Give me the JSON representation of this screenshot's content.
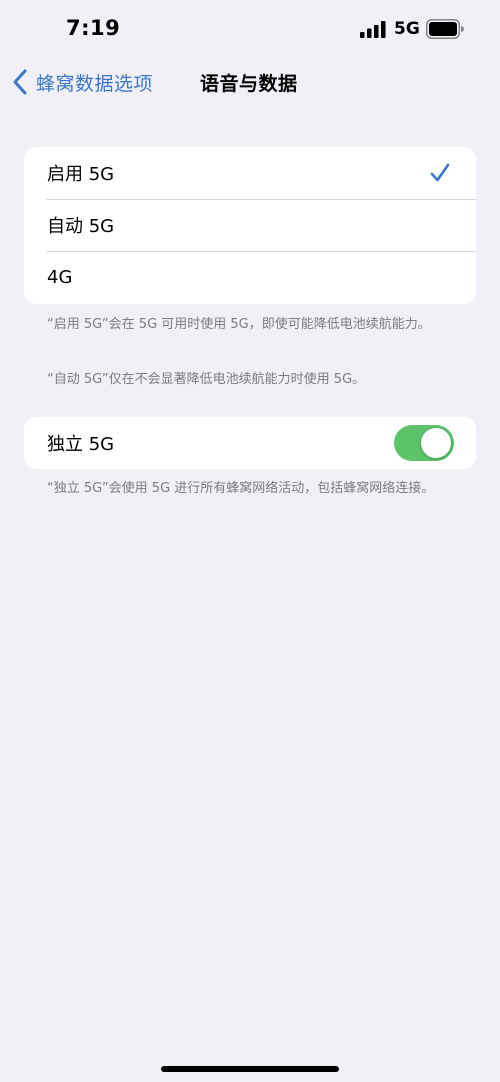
{
  "status_bar": {
    "time": "7:19",
    "network": "5G",
    "signal_icon": "cellular-signal-icon",
    "battery_icon": "battery-icon"
  },
  "nav": {
    "back_label": "蜂窝数据选项",
    "back_icon": "chevron-left-icon",
    "title": "语音与数据"
  },
  "options": {
    "items": [
      {
        "label": "启用 5G",
        "selected": true
      },
      {
        "label": "自动 5G",
        "selected": false
      },
      {
        "label": "4G",
        "selected": false
      }
    ],
    "check_icon": "checkmark-icon"
  },
  "notes": {
    "enable_5g": "“启用 5G”会在 5G 可用时使用 5G，即使可能降低电池续航能力。",
    "auto_5g": "“自动 5G”仅在不会显著降低电池续航能力时使用 5G。"
  },
  "standalone": {
    "label": "独立 5G",
    "enabled": true,
    "note": "“独立 5G”会使用 5G 进行所有蜂窝网络活动，包括蜂窝网络连接。"
  },
  "colors": {
    "accent": "#3a77c8",
    "toggle_on": "#5cc36a",
    "background": "#f0f0f6",
    "footnote": "#7b7b80"
  }
}
